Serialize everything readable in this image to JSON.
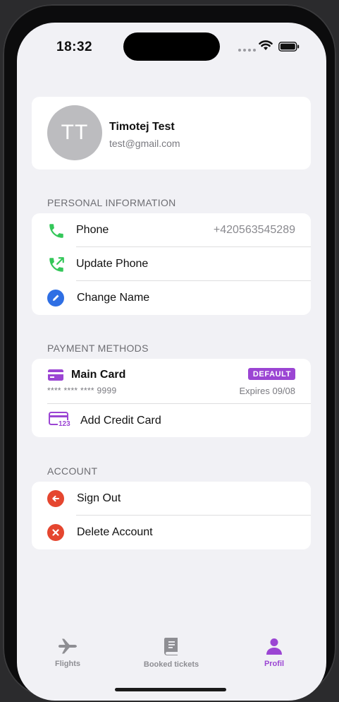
{
  "status_bar": {
    "time": "18:32"
  },
  "profile": {
    "initials": "TT",
    "name": "Timotej Test",
    "email": "test@gmail.com"
  },
  "personal": {
    "title": "PERSONAL INFORMATION",
    "phone_label": "Phone",
    "phone_value": "+420563545289",
    "update_phone": "Update Phone",
    "change_name": "Change Name"
  },
  "payment": {
    "title": "PAYMENT METHODS",
    "card_name": "Main Card",
    "badge": "DEFAULT",
    "card_number": "**** **** **** 9999",
    "expires": "Expires 09/08",
    "add_card": "Add Credit Card",
    "add_card_icon_text": "123"
  },
  "account": {
    "title": "ACCOUNT",
    "sign_out": "Sign Out",
    "delete": "Delete Account"
  },
  "tabs": [
    {
      "label": "Flights",
      "icon": "airplane-icon",
      "active": false
    },
    {
      "label": "Booked tickets",
      "icon": "book-icon",
      "active": false
    },
    {
      "label": "Profil",
      "icon": "person-icon",
      "active": true
    }
  ],
  "colors": {
    "accent": "#9b45d3",
    "phone_green": "#34c759",
    "edit_blue": "#2f6fe4",
    "danger_red": "#e5462f",
    "inactive_tab": "#8e8e93"
  }
}
